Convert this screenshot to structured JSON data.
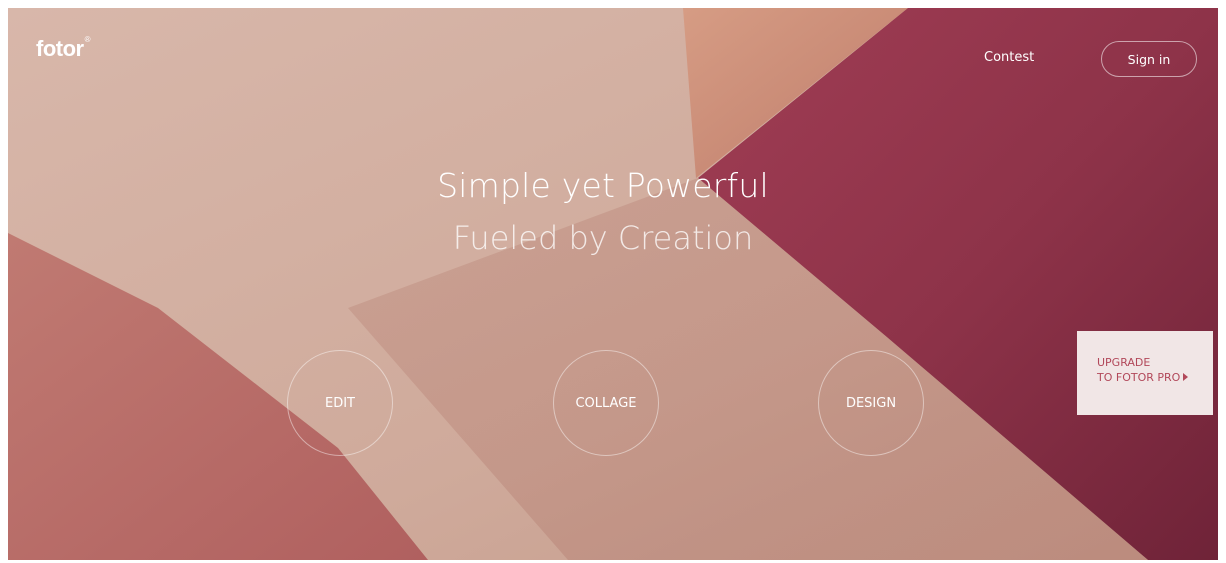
{
  "header": {
    "logo_text": "fotor",
    "logo_mark": "®",
    "nav_contest": "Contest",
    "nav_signin": "Sign in"
  },
  "hero": {
    "title": "Simple yet Powerful",
    "subtitle": "Fueled by Creation"
  },
  "actions": [
    {
      "label": "EDIT"
    },
    {
      "label": "COLLAGE"
    },
    {
      "label": "DESIGN"
    }
  ],
  "upgrade": {
    "line1": "UPGRADE",
    "line2": "TO FOTOR PRO",
    "icon": "play-arrow-icon"
  },
  "colors": {
    "background_light": "#d5b0a3",
    "background_crimson": "#8b3248",
    "background_coral": "#c98a78",
    "upgrade_text": "#b2485a",
    "upgrade_bg": "#f1e6e6"
  }
}
